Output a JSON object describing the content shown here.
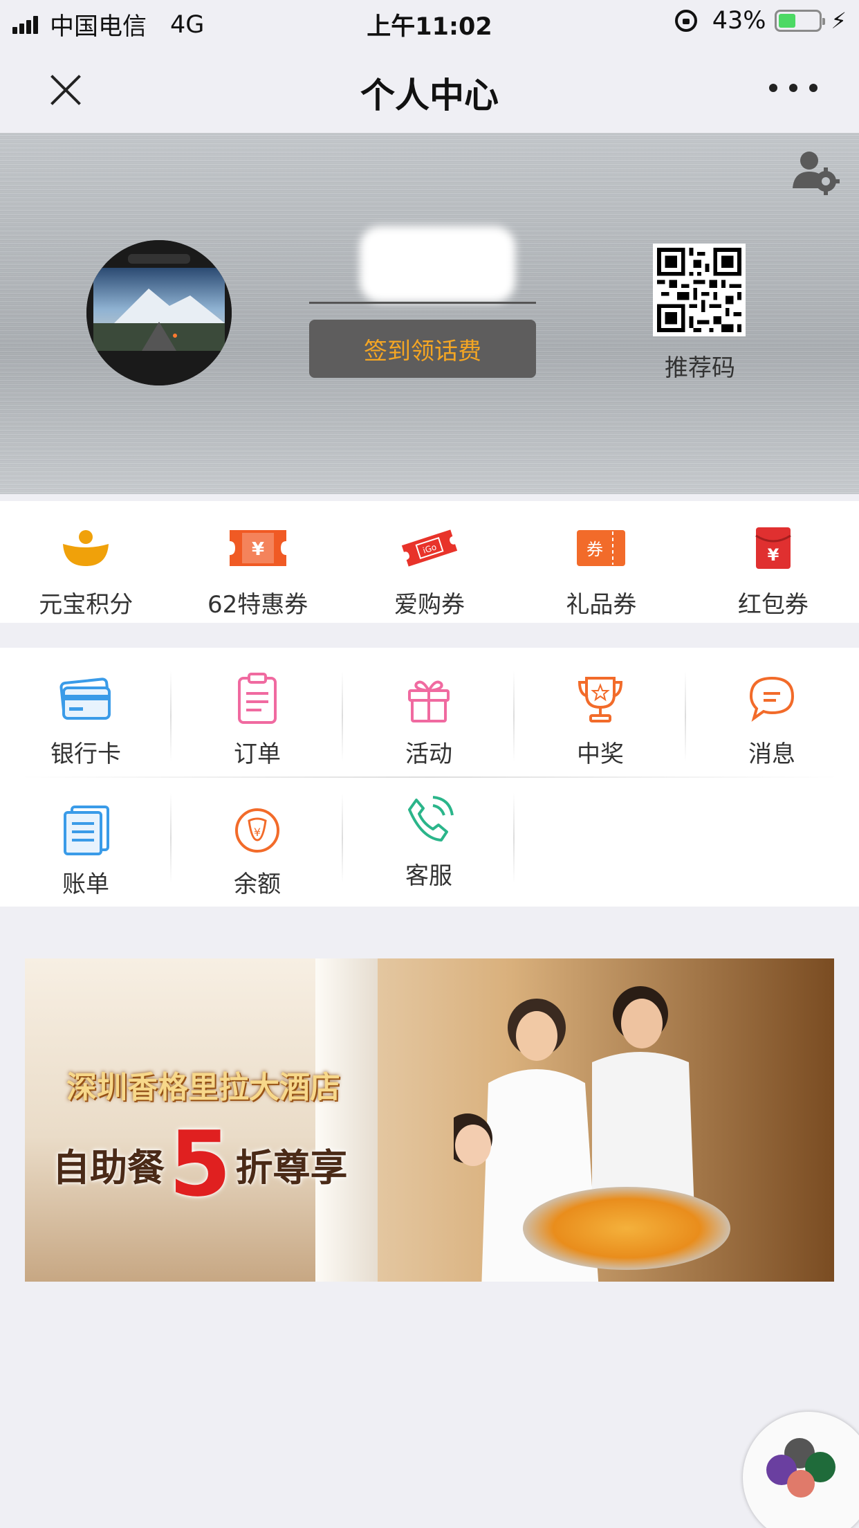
{
  "status_bar": {
    "carrier": "中国电信",
    "network": "4G",
    "time": "上午11:02",
    "battery_percent": "43%",
    "battery_level": 0.43
  },
  "nav": {
    "title": "个人中心",
    "close_icon": "close-icon",
    "more_icon": "more-icon"
  },
  "profile": {
    "checkin_label": "签到领话费",
    "qr_label": "推荐码",
    "settings_icon": "user-settings-icon"
  },
  "coupons": [
    {
      "label": "元宝积分",
      "icon": "points-icon",
      "color": "#f0a10a"
    },
    {
      "label": "62特惠券",
      "icon": "discount-ticket-icon",
      "color": "#f05a24"
    },
    {
      "label": "爱购券",
      "icon": "shopping-ticket-icon",
      "color": "#e8332a"
    },
    {
      "label": "礼品券",
      "icon": "gift-ticket-icon",
      "color": "#f26b2a"
    },
    {
      "label": "红包券",
      "icon": "red-envelope-icon",
      "color": "#e03030"
    }
  ],
  "coupon_ticket_text": {
    "discount": "¥",
    "shopping": "iGo",
    "gift": "券",
    "envelope": "¥"
  },
  "services": [
    {
      "label": "银行卡",
      "icon": "bank-card-icon",
      "color": "#3a9be8"
    },
    {
      "label": "订单",
      "icon": "order-icon",
      "color": "#f06aa0"
    },
    {
      "label": "活动",
      "icon": "gift-icon",
      "color": "#f06aa0"
    },
    {
      "label": "中奖",
      "icon": "trophy-icon",
      "color": "#f26b2a"
    },
    {
      "label": "消息",
      "icon": "message-icon",
      "color": "#f26b2a"
    },
    {
      "label": "账单",
      "icon": "bill-icon",
      "color": "#3a9be8"
    },
    {
      "label": "余额",
      "icon": "balance-icon",
      "color": "#f26b2a"
    },
    {
      "label": "客服",
      "icon": "phone-icon",
      "color": "#2bb58a"
    }
  ],
  "banner": {
    "title": "深圳香格里拉大酒店",
    "promo_prefix": "自助餐",
    "promo_number": "5",
    "promo_suffix": "折尊享"
  }
}
